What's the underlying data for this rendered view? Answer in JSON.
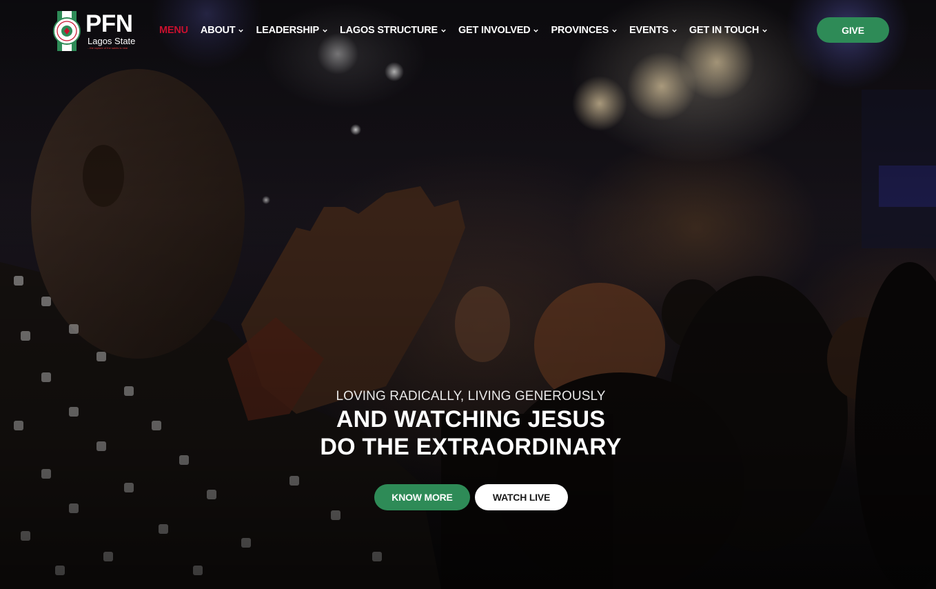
{
  "brand": {
    "name": "PFN",
    "subtitle": "Lagos State",
    "tagline": "...the rapture of the saints is near",
    "colors": {
      "green": "#2e8b57",
      "red": "#c8102e"
    }
  },
  "nav": {
    "items": [
      {
        "label": "MENU",
        "active": true,
        "has_dropdown": false
      },
      {
        "label": "ABOUT",
        "has_dropdown": true
      },
      {
        "label": "LEADERSHIP",
        "has_dropdown": true
      },
      {
        "label": "LAGOS STRUCTURE",
        "has_dropdown": true
      },
      {
        "label": "GET INVOLVED",
        "has_dropdown": true
      },
      {
        "label": "PROVINCES",
        "has_dropdown": true
      },
      {
        "label": "EVENTS",
        "has_dropdown": true
      },
      {
        "label": "GET IN TOUCH",
        "has_dropdown": true
      }
    ],
    "give_label": "GIVE"
  },
  "hero": {
    "kicker": "LOVING RADICALLY, LIVING GENEROUSLY",
    "title_line1": "AND WATCHING JESUS",
    "title_line2": "DO THE EXTRAORDINARY",
    "primary_cta": "KNOW MORE",
    "secondary_cta": "WATCH LIVE",
    "background_icon": "worship-crowd-photo"
  }
}
